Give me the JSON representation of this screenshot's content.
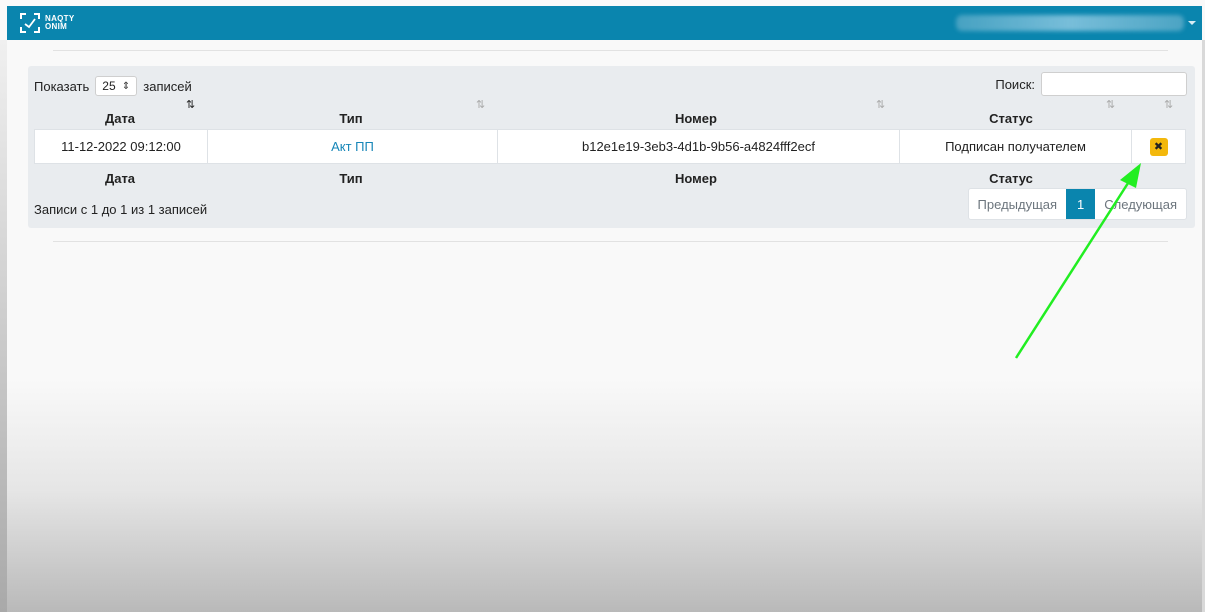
{
  "navbar": {
    "logo_line1": "NAQTY",
    "logo_line2": "ONIM",
    "brand_color": "#0a85ae"
  },
  "table_controls": {
    "show_label": "Показать",
    "page_length": "25",
    "entries_label": "записей",
    "search_label": "Поиск:",
    "search_value": ""
  },
  "columns": [
    "Дата",
    "Тип",
    "Номер",
    "Статус"
  ],
  "rows": [
    {
      "date": "11-12-2022 09:12:00",
      "type": "Акт ПП",
      "number": "b12e1e19-3eb3-4d1b-9b56-a4824fff2ecf",
      "status": "Подписан получателем",
      "action_icon": "close-icon"
    }
  ],
  "footer": {
    "info": "Записи с 1 до 1 из 1 записей",
    "prev": "Предыдущая",
    "page": "1",
    "next": "Следующая"
  },
  "colors": {
    "delete_button": "#f3b80c",
    "annotation_arrow": "#22ee22",
    "link": "#1686b8"
  }
}
